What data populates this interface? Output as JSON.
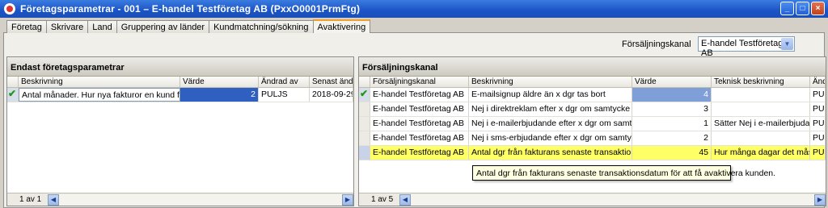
{
  "window": {
    "title": "Företagsparametrar - 001 – E-handel Testföretag AB (PxxO0001PrmFtg)"
  },
  "tabs": [
    "Företag",
    "Skrivare",
    "Land",
    "Gruppering av länder",
    "Kundmatchning/sökning",
    "Avaktivering"
  ],
  "active_tab": 5,
  "kanal_select": {
    "label": "Försäljningskanal",
    "value": "E-handel Testföretag AB"
  },
  "left_panel": {
    "title": "Endast företagsparametrar",
    "columns": [
      "Beskrivning",
      "Värde",
      "Ändrad av",
      "Senast ändrad"
    ],
    "rows": [
      {
        "beskrivning": "Antal månader. Hur nya fakturor en kund får ha f...",
        "varde": "2",
        "andrad_av": "PULJS",
        "senast": "2018-09-29"
      }
    ],
    "pager": "1 av 1"
  },
  "right_panel": {
    "title": "Försäljningskanal",
    "columns": [
      "Försäljningskanal",
      "Beskrivning",
      "Värde",
      "Teknisk beskrivning",
      "Ändrad av"
    ],
    "rows": [
      {
        "kanal": "E-handel Testföretag AB",
        "beskrivning": "E-mailsignup äldre än x dgr tas bort",
        "varde": "4",
        "teknisk": "",
        "andrad": "PUL"
      },
      {
        "kanal": "E-handel Testföretag AB",
        "beskrivning": "Nej i direktreklam efter x dgr om samtycke saknas",
        "varde": "3",
        "teknisk": "",
        "andrad": "PUL"
      },
      {
        "kanal": "E-handel Testföretag AB",
        "beskrivning": "Nej i e-mailerbjudande efter x dgr om samtycke sak...",
        "varde": "1",
        "teknisk": "Sätter Nej i e-mailerbjudand...",
        "andrad": "PUL"
      },
      {
        "kanal": "E-handel Testföretag AB",
        "beskrivning": "Nej i sms-erbjudande efter x dgr om samtycke sak...",
        "varde": "2",
        "teknisk": "",
        "andrad": "PUL"
      },
      {
        "kanal": "E-handel Testföretag AB",
        "beskrivning": "Antal dgr från fakturans senaste transaktionsdatu...",
        "varde": "45",
        "teknisk": "Hur många dagar det måste...",
        "andrad": "PUL"
      }
    ],
    "pager": "1 av 5"
  },
  "tooltip": "Antal dgr från fakturans senaste transaktionsdatum för att få avaktivera kunden.",
  "colors": {
    "title_bar": "#1b54c6",
    "selected_cell": "#2f5fc0",
    "highlight_row": "#ffff66",
    "tooltip_bg": "#ffffe1"
  }
}
